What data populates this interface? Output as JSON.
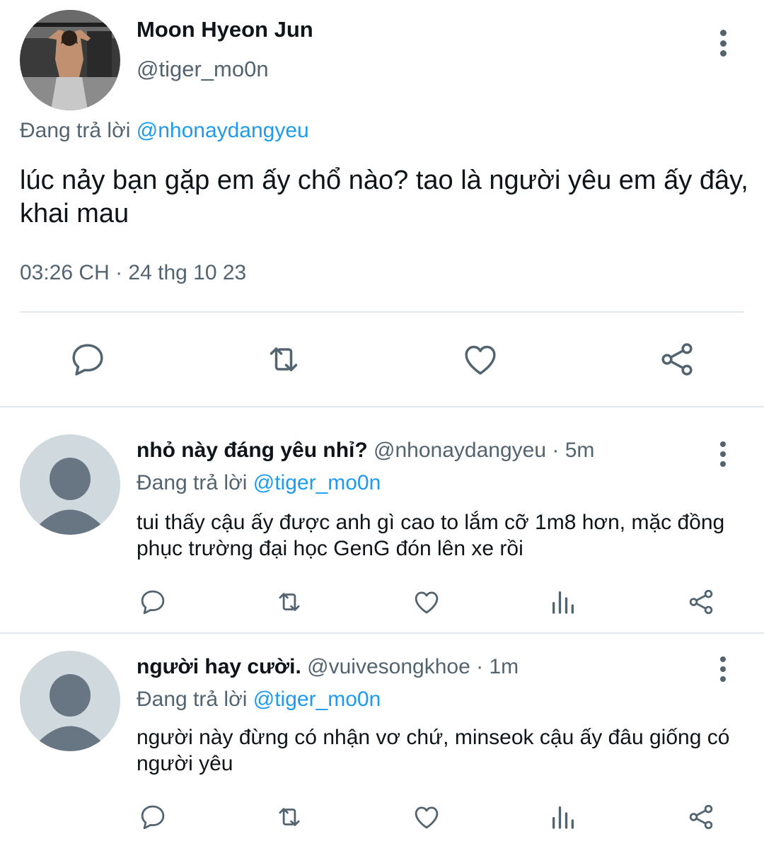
{
  "main_tweet": {
    "author_name": "Moon Hyeon Jun",
    "author_handle": "@tiger_mo0n",
    "replying_label": "Đang trả lời",
    "replying_to": "@nhonaydangyeu",
    "text": "lúc nảy bạn gặp em ấy chổ nào? tao là người yêu em ấy đây, khai mau",
    "timestamp": "03:26 CH · 24 thg 10 23",
    "actions": [
      "reply-icon",
      "retweet-icon",
      "heart-icon",
      "share-icon"
    ]
  },
  "replies": [
    {
      "name": "nhỏ này đáng yêu nhỉ?",
      "handle": "@nhonaydangyeu",
      "separator": "·",
      "time": "5m",
      "replying_label": "Đang trả lời",
      "replying_to": "@tiger_mo0n",
      "text": "tui thấy cậu ấy được anh gì cao to lắm cỡ 1m8 hơn, mặc đồng phục trường đại học GenG đón lên xe rồi",
      "actions": [
        "reply-icon",
        "retweet-icon",
        "heart-icon",
        "analytics-icon",
        "share-icon"
      ]
    },
    {
      "name": "người hay cười.",
      "handle": "@vuivesongkhoe",
      "separator": "·",
      "time": "1m",
      "replying_label": "Đang trả lời",
      "replying_to": "@tiger_mo0n",
      "text": "người này đừng có nhận vơ chứ, minseok cậu ấy đâu giống có người yêu",
      "actions": [
        "reply-icon",
        "retweet-icon",
        "heart-icon",
        "analytics-icon",
        "share-icon"
      ]
    }
  ],
  "colors": {
    "text_primary": "#0f1419",
    "text_secondary": "#536471",
    "mention": "#1d9bf0",
    "divider": "#e1e8ed",
    "avatar_default_bg": "#cfd9de",
    "avatar_default_fg": "#687684"
  }
}
